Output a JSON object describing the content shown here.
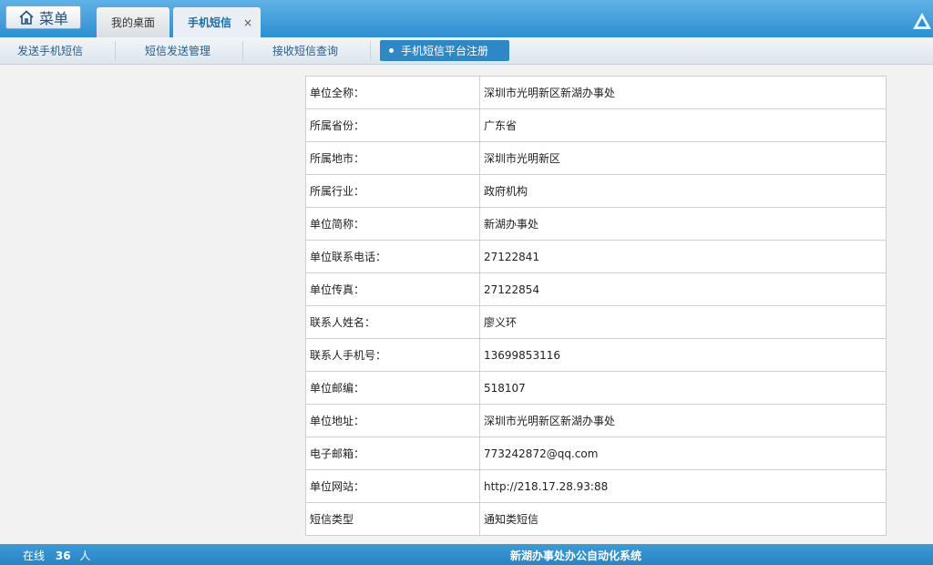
{
  "header": {
    "menu_label": "菜单",
    "tabs": [
      {
        "label": "我的桌面",
        "active": false
      },
      {
        "label": "手机短信",
        "active": true,
        "close": "×"
      }
    ]
  },
  "subnav": {
    "items": [
      "发送手机短信",
      "短信发送管理",
      "接收短信查询"
    ],
    "active_item": "手机短信平台注册"
  },
  "form": {
    "rows": [
      {
        "label": "单位全称：",
        "value": "深圳市光明新区新湖办事处"
      },
      {
        "label": "所属省份：",
        "value": "广东省"
      },
      {
        "label": "所属地市：",
        "value": "深圳市光明新区"
      },
      {
        "label": "所属行业：",
        "value": "政府机构"
      },
      {
        "label": "单位简称：",
        "value": "新湖办事处"
      },
      {
        "label": "单位联系电话：",
        "value": "27122841"
      },
      {
        "label": "单位传真：",
        "value": "27122854"
      },
      {
        "label": "联系人姓名：",
        "value": "廖义环"
      },
      {
        "label": "联系人手机号：",
        "value": "13699853116"
      },
      {
        "label": "单位邮编：",
        "value": "518107"
      },
      {
        "label": "单位地址：",
        "value": "深圳市光明新区新湖办事处"
      },
      {
        "label": "电子邮箱：",
        "value": "773242872@qq.com"
      },
      {
        "label": "单位网站：",
        "value": "http://218.17.28.93:88"
      },
      {
        "label": "短信类型",
        "value": "通知类短信"
      }
    ]
  },
  "footer": {
    "online_prefix": "在线",
    "online_count": "36",
    "online_suffix": "人",
    "system_name": "新湖办事处办公自动化系统"
  },
  "colors": {
    "header": "#2f8fd0",
    "footer": "#2a84c4",
    "active_subnav": "#2f88c6"
  }
}
